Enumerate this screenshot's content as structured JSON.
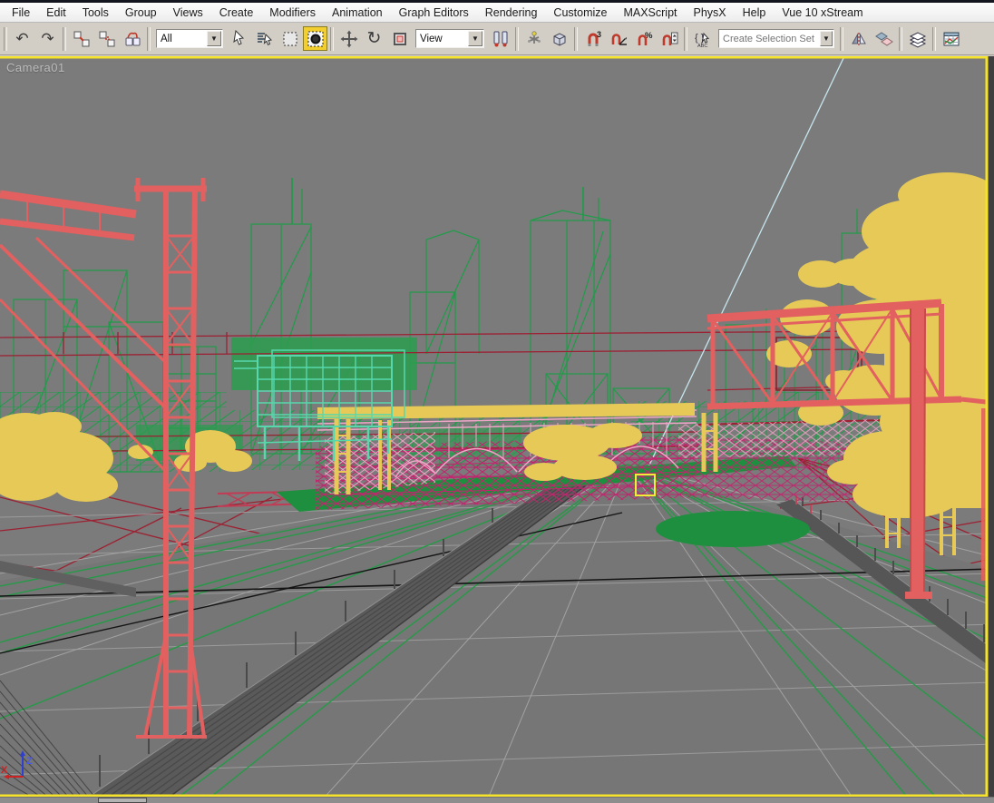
{
  "menubar": {
    "items": [
      "File",
      "Edit",
      "Tools",
      "Group",
      "Views",
      "Create",
      "Modifiers",
      "Animation",
      "Graph Editors",
      "Rendering",
      "Customize",
      "MAXScript",
      "PhysX",
      "Help",
      "Vue 10 xStream"
    ]
  },
  "toolbar": {
    "selection_filter": {
      "value": "All"
    },
    "reference_coordinate": {
      "value": "View"
    },
    "named_selection_combo": {
      "placeholder": "Create Selection Set"
    },
    "snap_superscripts": {
      "snap3": "3",
      "percent": "%"
    },
    "icon_names": [
      "undo-icon",
      "redo-icon",
      "select-link-icon",
      "unlink-selection-icon",
      "bind-spacewarp-icon",
      "selection-filter-dropdown",
      "select-object-icon",
      "select-by-name-icon",
      "rectangular-selection-icon",
      "crossing-selection-icon",
      "select-move-icon",
      "select-rotate-icon",
      "select-scale-icon",
      "reference-coordinate-dropdown",
      "use-pivot-center-icon",
      "select-manipulate-icon",
      "keyboard-override-icon",
      "snap-toggle-icon",
      "angle-snap-icon",
      "percent-snap-icon",
      "spinner-snap-icon",
      "named-selection-sets-icon",
      "named-selection-combo",
      "mirror-icon",
      "align-icon",
      "layer-manager-icon",
      "curve-editor-icon"
    ]
  },
  "viewport": {
    "label": "Camera01",
    "axis": {
      "x": "X",
      "z": "Z"
    },
    "colors": {
      "background": "#7b7b7b",
      "active_border": "#f5e22a",
      "wire_green": "#1f9c49",
      "wire_red": "#e2605f",
      "wire_crimson": "#9c2133",
      "wire_magenta": "#c2246e",
      "wire_pink": "#efa6c6",
      "wire_teal": "#57d8ac",
      "foliage_yellow": "#e6c957",
      "road_gray": "#767676",
      "selection_yellow": "#f0ee35",
      "axis_x_red": "#cc2222",
      "axis_z_blue": "#3a4ad8"
    }
  }
}
